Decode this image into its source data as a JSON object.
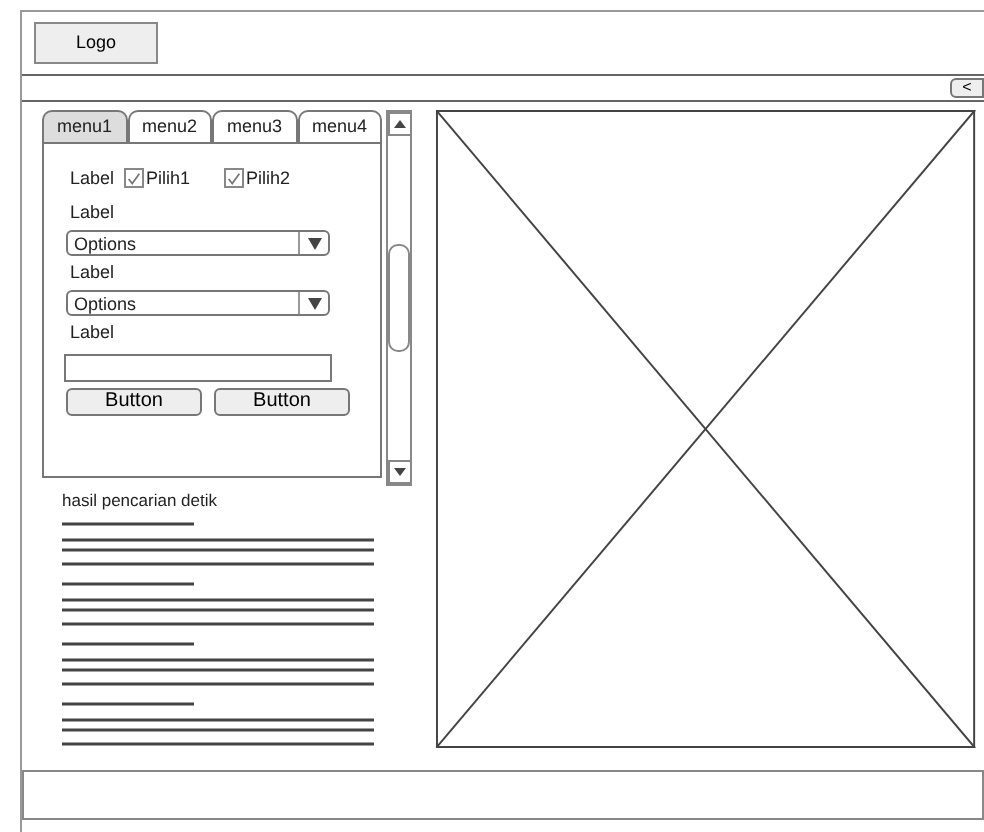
{
  "header": {
    "logo": "Logo"
  },
  "toolbar": {
    "collapse_button": "<"
  },
  "tabs": [
    {
      "label": "menu1",
      "selected": true
    },
    {
      "label": "menu2",
      "selected": false
    },
    {
      "label": "menu3",
      "selected": false
    },
    {
      "label": "menu4",
      "selected": false
    }
  ],
  "form": {
    "row_label": "Label",
    "checkboxes": [
      {
        "label": "Pilih1",
        "checked": true
      },
      {
        "label": "Pilih2",
        "checked": true
      }
    ],
    "fields": [
      {
        "kind": "select",
        "label": "Label",
        "value": "Options"
      },
      {
        "kind": "select",
        "label": "Label",
        "value": "Options"
      },
      {
        "kind": "text",
        "label": "Label"
      }
    ],
    "buttons": [
      "Button",
      "Button"
    ]
  },
  "results": {
    "heading": "hasil pencarian  detik"
  }
}
